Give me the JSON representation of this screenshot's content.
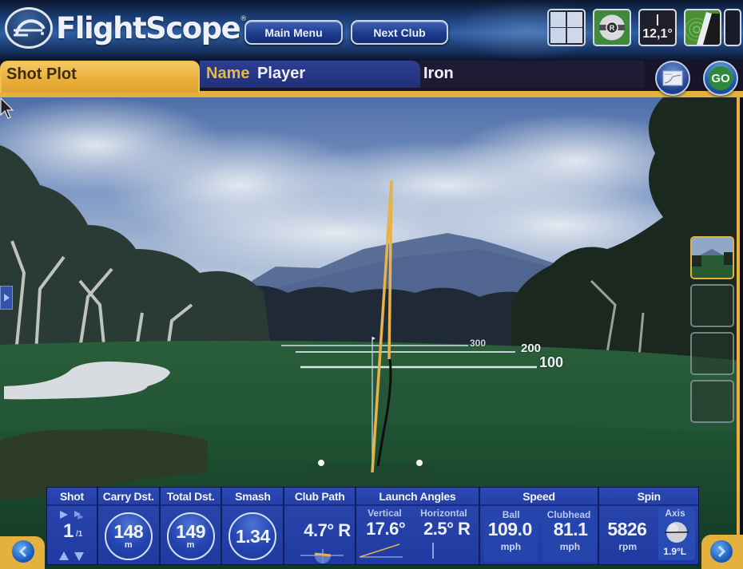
{
  "app": {
    "brand": "FlightScope",
    "registered_mark": "®"
  },
  "header": {
    "main_menu_label": "Main Menu",
    "next_club_label": "Next Club",
    "tools": [
      {
        "name": "layout-grid",
        "icon": "grid-icon"
      },
      {
        "name": "ball-view",
        "icon": "ball-icon",
        "glyph": "R"
      },
      {
        "name": "launch-angle",
        "icon": "angle-icon",
        "value": "12,1°"
      },
      {
        "name": "radar",
        "icon": "radar-icon"
      },
      {
        "name": "extra",
        "icon": "blank"
      }
    ]
  },
  "tabs": {
    "active_tab": "Shot Plot",
    "name_label": "Name",
    "name_value": "Player",
    "club": "Iron",
    "report_button_icon": "report-icon",
    "go_label": "GO"
  },
  "scene": {
    "distance_markers": [
      "300",
      "200",
      "100"
    ],
    "thumbnails": [
      {
        "label": "view-1",
        "active": true
      },
      {
        "label": "view-2",
        "active": false
      },
      {
        "label": "view-3",
        "active": false
      },
      {
        "label": "view-4",
        "active": false
      }
    ],
    "colors": {
      "trajectory": "#e8b24a",
      "ground_track": "#111111",
      "accent_gold": "#e4b13e"
    }
  },
  "stats": {
    "shot": {
      "header": "Shot",
      "value": "1",
      "of": "/1"
    },
    "carry": {
      "header": "Carry Dst.",
      "value": "148",
      "unit": "m"
    },
    "total": {
      "header": "Total Dst.",
      "value": "149",
      "unit": "m"
    },
    "smash": {
      "header": "Smash",
      "value": "1.34"
    },
    "club_path": {
      "header": "Club Path",
      "value": "4.7° R"
    },
    "launch": {
      "header": "Launch Angles",
      "vertical_label": "Vertical",
      "vertical_value": "17.6°",
      "horizontal_label": "Horizontal",
      "horizontal_value": "2.5° R"
    },
    "speed": {
      "header": "Speed",
      "ball_label": "Ball",
      "ball_value": "109.0",
      "ball_unit": "mph",
      "club_label": "Clubhead",
      "club_value": "81.1",
      "club_unit": "mph"
    },
    "spin": {
      "header": "Spin",
      "value": "5826",
      "unit": "rpm",
      "axis_label": "Axis",
      "axis_value": "1.9°L"
    }
  }
}
